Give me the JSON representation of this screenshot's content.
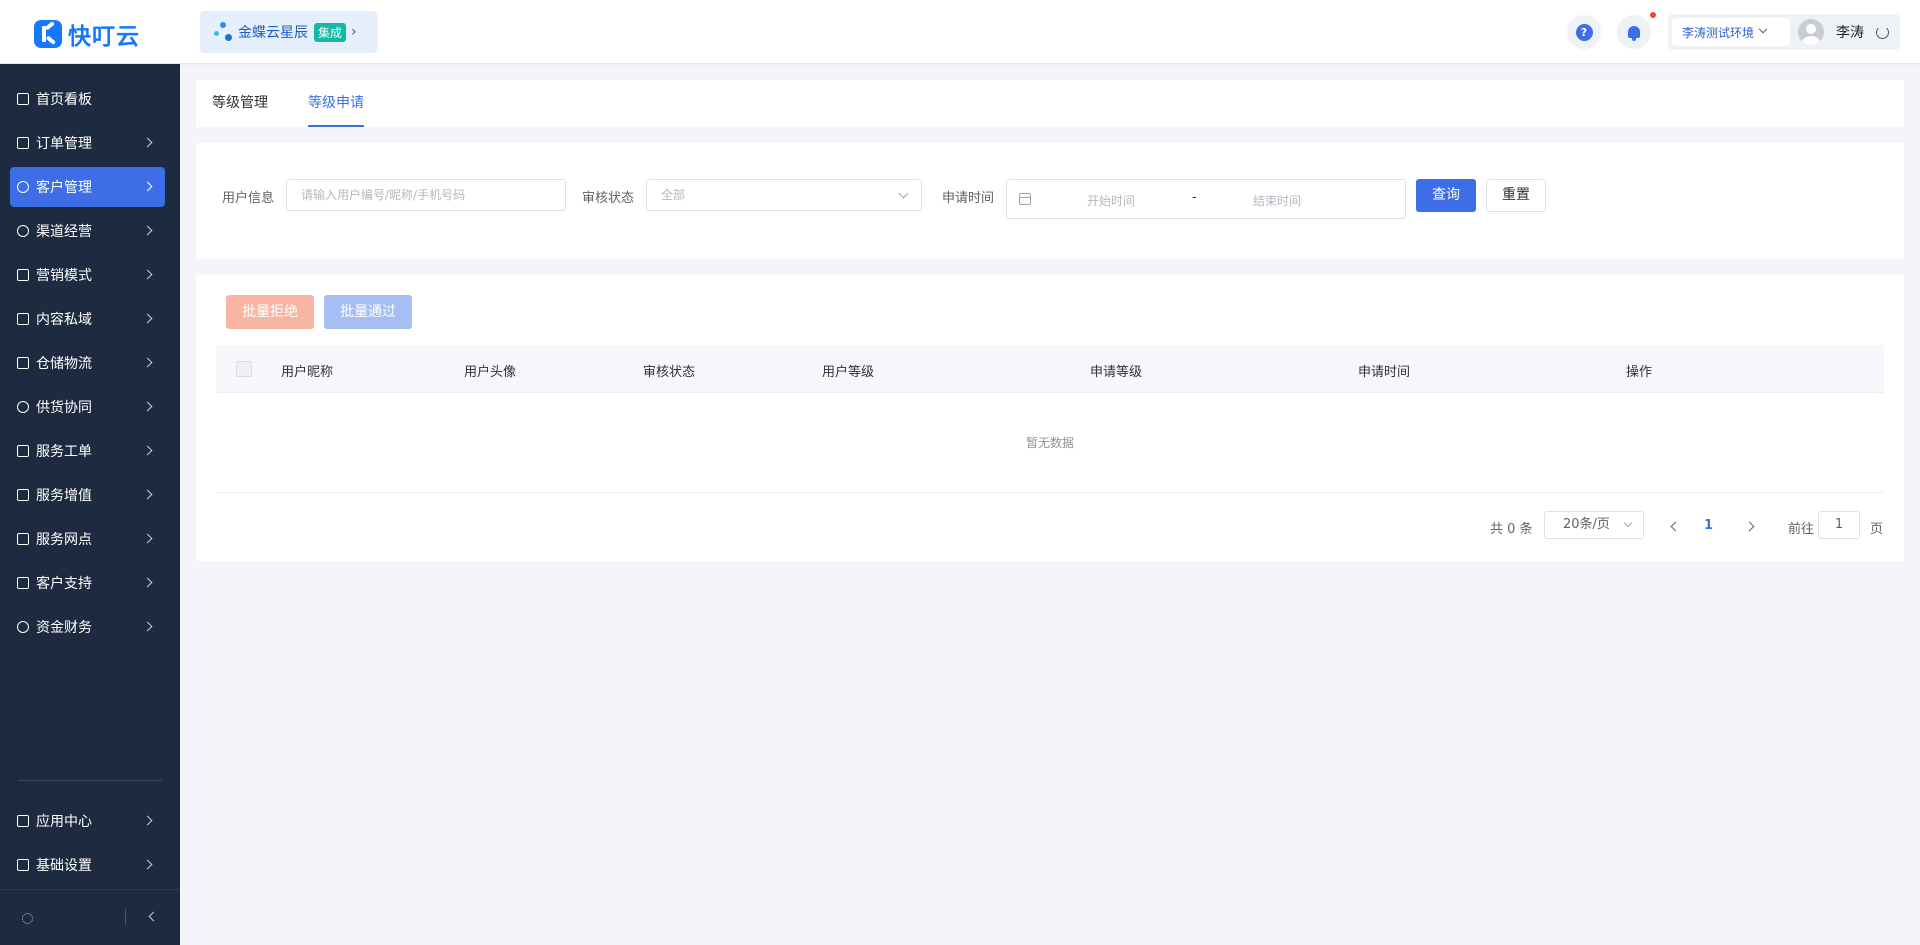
{
  "app": {
    "logo_text": "快叮云"
  },
  "brand": {
    "name": "金蝶云星辰",
    "badge": "集成"
  },
  "header": {
    "environment": "李涛测试环境",
    "user_name": "李涛"
  },
  "sidebar": {
    "items": [
      {
        "label": "首页看板"
      },
      {
        "label": "订单管理"
      },
      {
        "label": "客户管理"
      },
      {
        "label": "渠道经营"
      },
      {
        "label": "营销模式"
      },
      {
        "label": "内容私域"
      },
      {
        "label": "仓储物流"
      },
      {
        "label": "供货协同"
      },
      {
        "label": "服务工单"
      },
      {
        "label": "服务增值"
      },
      {
        "label": "服务网点"
      },
      {
        "label": "客户支持"
      },
      {
        "label": "资金财务"
      }
    ],
    "bottom_items": [
      {
        "label": "应用中心"
      },
      {
        "label": "基础设置"
      }
    ],
    "active_item": "客户管理"
  },
  "tabs": [
    {
      "label": "等级管理"
    },
    {
      "label": "等级申请"
    }
  ],
  "active_tab": "等级申请",
  "filters": {
    "user_info_label": "用户信息",
    "user_info_placeholder": "请输入用户编号/昵称/手机号码",
    "status_label": "审核状态",
    "status_value": "全部",
    "time_label": "申请时间",
    "start_placeholder": "开始时间",
    "separator": "-",
    "end_placeholder": "结束时间",
    "query_button": "查询",
    "reset_button": "重置"
  },
  "actions": {
    "bulk_reject": "批量拒绝",
    "bulk_pass": "批量通过"
  },
  "table": {
    "columns": [
      "用户昵称",
      "用户头像",
      "审核状态",
      "用户等级",
      "申请等级",
      "申请时间",
      "操作"
    ],
    "rows": [],
    "empty_text": "暂无数据"
  },
  "pagination": {
    "total": "共 0 条",
    "page_size": "20条/页",
    "current_page": "1",
    "goto_label": "前往",
    "goto_value": "1",
    "page_suffix": "页"
  },
  "colors": {
    "primary": "#3d6ee8",
    "sidebar_bg": "#1e2a3f",
    "logo_blue": "#1677ff",
    "reject_disabled": "#f8b5a3",
    "pass_disabled": "#a7bef2",
    "badge_teal": "#14b8a6"
  },
  "icons": {
    "help": "question-circle-icon",
    "notifications": "bell-icon",
    "refresh": "refresh-icon",
    "calendar": "calendar-icon"
  }
}
